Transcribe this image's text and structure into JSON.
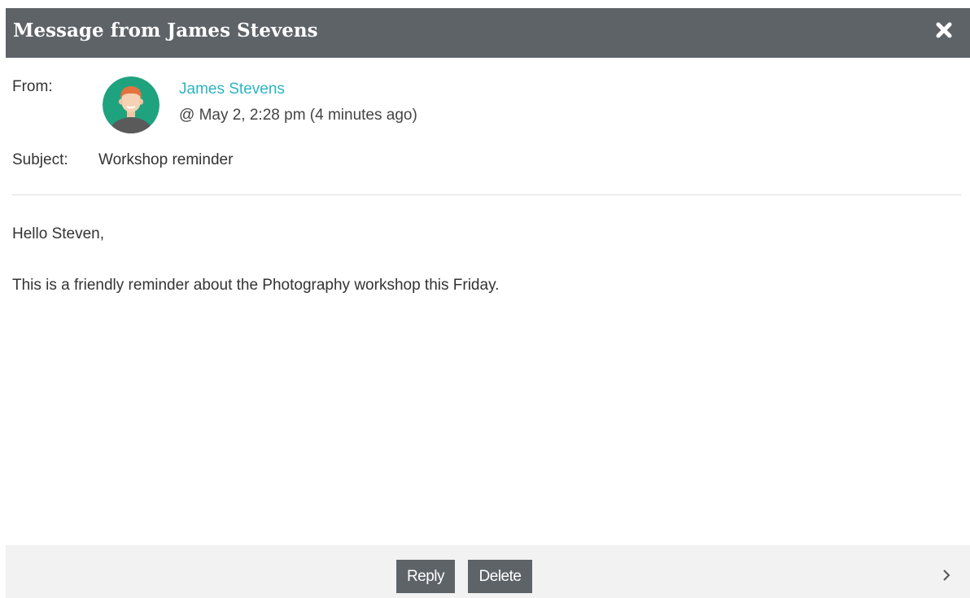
{
  "dialog": {
    "title": "Message from James Stevens"
  },
  "message": {
    "from_label": "From:",
    "sender_name": "James Stevens",
    "sent_time": "@ May 2, 2:28 pm (4 minutes ago)",
    "subject_label": "Subject:",
    "subject": "Workshop reminder",
    "greeting": "Hello Steven,",
    "body": "This is a friendly reminder about the Photography workshop this Friday."
  },
  "footer": {
    "reply_label": "Reply",
    "delete_label": "Delete"
  },
  "colors": {
    "titlebar": "#5e6368",
    "link": "#2bb5c2",
    "avatar_bg": "#1fa37f",
    "footer_bg": "#f2f2f2"
  },
  "icons": {
    "close": "close-icon",
    "next": "chevron-right-icon",
    "avatar": "avatar-icon"
  }
}
